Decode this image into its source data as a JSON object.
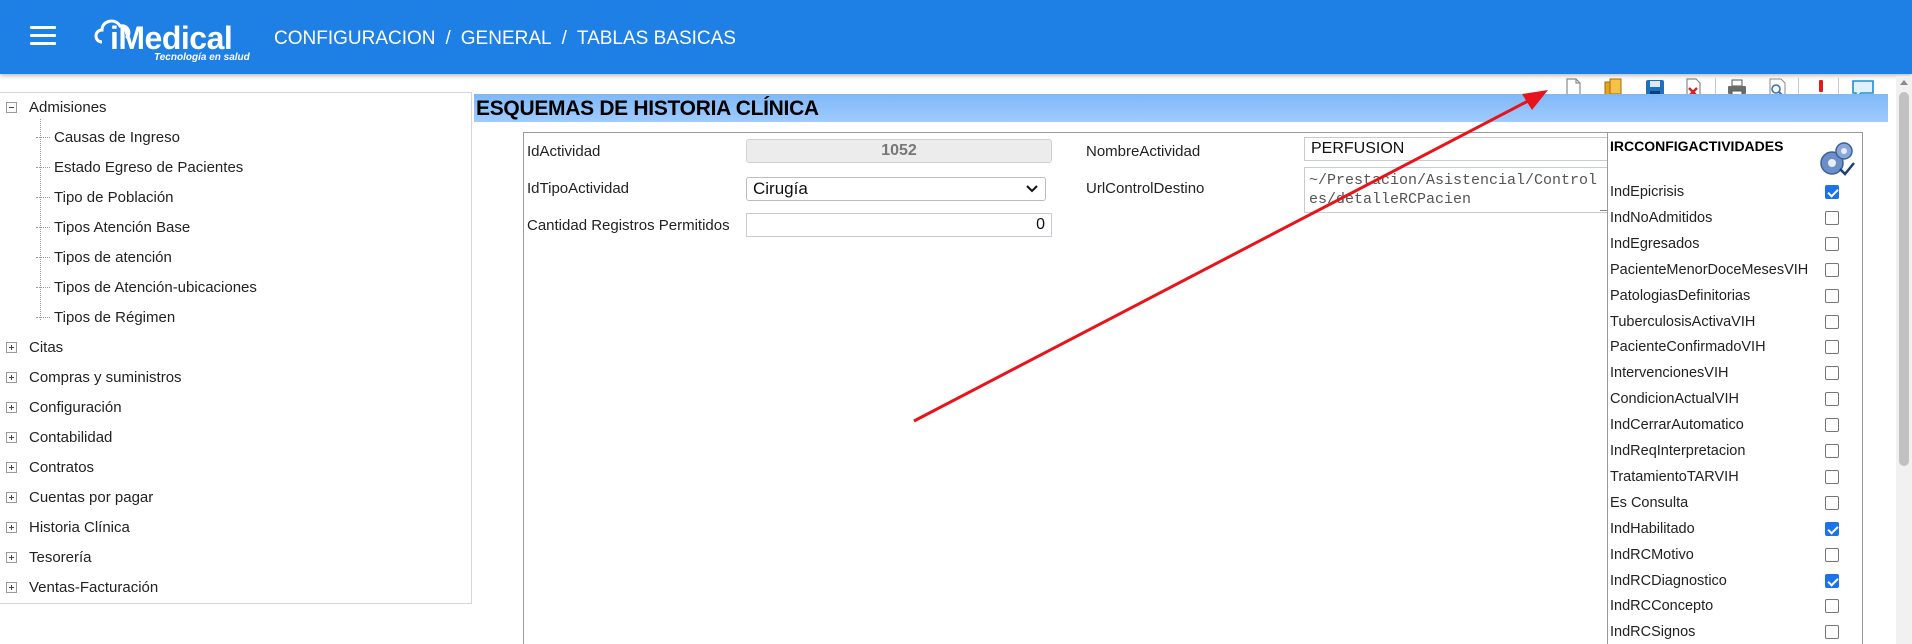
{
  "header": {
    "menu_icon": "hamburger-menu-icon",
    "logo_text": "iMedical",
    "logo_tagline": "Tecnología en salud",
    "breadcrumb": [
      "CONFIGURACION",
      "GENERAL",
      "TABLAS BASICAS"
    ],
    "breadcrumb_sep": "/",
    "bar_color": "#1e7fe4"
  },
  "tree": {
    "expanded": {
      "label": "Admisiones",
      "children": [
        "Causas de Ingreso",
        "Estado Egreso de Pacientes",
        "Tipo de Población",
        "Tipos Atención Base",
        "Tipos de atención",
        "Tipos de Atención-ubicaciones",
        "Tipos de Régimen"
      ]
    },
    "collapsed": [
      "Citas",
      "Compras y suministros",
      "Configuración",
      "Contabilidad",
      "Contratos",
      "Cuentas por pagar",
      "Historia Clínica",
      "Tesorería",
      "Ventas-Facturación"
    ]
  },
  "toolbar": {
    "icons": [
      "new-document-icon",
      "copy-icon",
      "save-icon",
      "delete-icon",
      "print-icon",
      "preview-icon",
      "alert-icon",
      "comment-icon"
    ]
  },
  "page": {
    "title": "ESQUEMAS DE HISTORIA CLÍNICA",
    "title_bar_color": "#9fcbff"
  },
  "form": {
    "id_actividad": {
      "label": "IdActividad",
      "value": "1052"
    },
    "id_tipo_actividad": {
      "label": "IdTipoActividad",
      "value": "Cirugía"
    },
    "cantidad_registros": {
      "label": "Cantidad Registros Permitidos",
      "value": "0"
    },
    "nombre_actividad": {
      "label": "NombreActividad",
      "value": "PERFUSION"
    },
    "url_control_destino": {
      "label": "UrlControlDestino",
      "line1": "~/Prestacion/Asistencial/Control",
      "line2": "es/detalleRCPacien"
    }
  },
  "checklist": {
    "heading": "IRCCONFIGACTIVIDADES",
    "heading_icon": "gear-config-icon",
    "items": [
      {
        "label": "IndEpicrisis",
        "checked": true
      },
      {
        "label": "IndNoAdmitidos",
        "checked": false
      },
      {
        "label": "IndEgresados",
        "checked": false
      },
      {
        "label": "PacienteMenorDoceMesesVIH",
        "checked": false
      },
      {
        "label": "PatologiasDefinitorias",
        "checked": false
      },
      {
        "label": "TuberculosisActivaVIH",
        "checked": false
      },
      {
        "label": "PacienteConfirmadoVIH",
        "checked": false
      },
      {
        "label": "IntervencionesVIH",
        "checked": false
      },
      {
        "label": "CondicionActualVIH",
        "checked": false
      },
      {
        "label": "IndCerrarAutomatico",
        "checked": false
      },
      {
        "label": "IndReqInterpretacion",
        "checked": false
      },
      {
        "label": "TratamientoTARVIH",
        "checked": false
      },
      {
        "label": "Es Consulta",
        "checked": false
      },
      {
        "label": "IndHabilitado",
        "checked": true
      },
      {
        "label": "IndRCMotivo",
        "checked": false
      },
      {
        "label": "IndRCDiagnostico",
        "checked": true
      },
      {
        "label": "IndRCConcepto",
        "checked": false
      },
      {
        "label": "IndRCSignos",
        "checked": false
      }
    ]
  },
  "annotation": {
    "color": "#e8141b"
  }
}
